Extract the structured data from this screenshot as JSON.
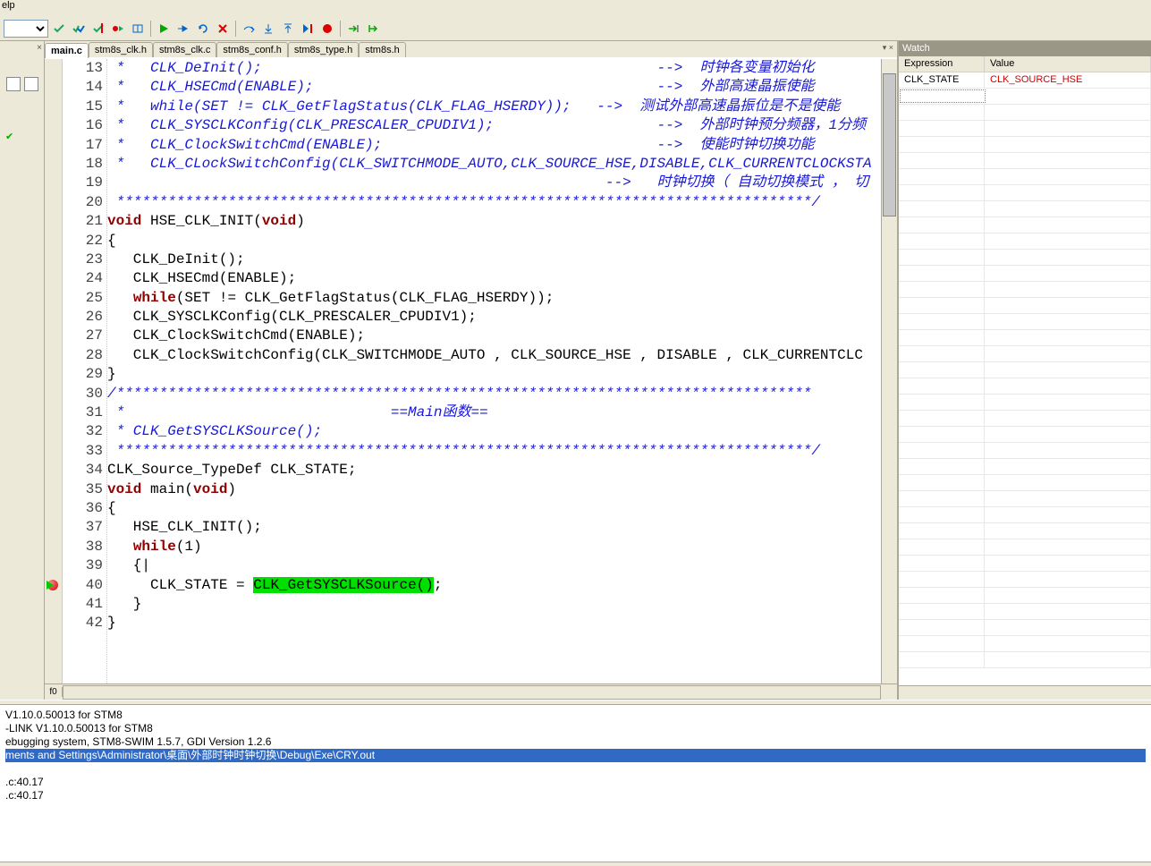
{
  "menubar": {
    "item_visible": "elp"
  },
  "tabs": [
    {
      "label": "main.c",
      "active": true
    },
    {
      "label": "stm8s_clk.h",
      "active": false
    },
    {
      "label": "stm8s_clk.c",
      "active": false
    },
    {
      "label": "stm8s_conf.h",
      "active": false
    },
    {
      "label": "stm8s_type.h",
      "active": false
    },
    {
      "label": "stm8s.h",
      "active": false
    }
  ],
  "code": {
    "first_line": 13,
    "lines": [
      {
        "n": 13,
        "type": "comment",
        "text": " *   CLK_DeInit();                                              -->  时钟各变量初始化"
      },
      {
        "n": 14,
        "type": "comment",
        "text": " *   CLK_HSECmd(ENABLE);                                        -->  外部高速晶振使能"
      },
      {
        "n": 15,
        "type": "comment",
        "text": " *   while(SET != CLK_GetFlagStatus(CLK_FLAG_HSERDY));   -->  测试外部高速晶振位是不是使能"
      },
      {
        "n": 16,
        "type": "comment",
        "text": " *   CLK_SYSCLKConfig(CLK_PRESCALER_CPUDIV1);                   -->  外部时钟预分频器，1分频"
      },
      {
        "n": 17,
        "type": "comment",
        "text": " *   CLK_ClockSwitchCmd(ENABLE);                                -->  使能时钟切换功能"
      },
      {
        "n": 18,
        "type": "comment",
        "text": " *   CLK_CLockSwitchConfig(CLK_SWITCHMODE_AUTO,CLK_SOURCE_HSE,DISABLE,CLK_CURRENTCLOCKSTA"
      },
      {
        "n": 19,
        "type": "comment",
        "text": "                                                          -->   时钟切换（ 自动切换模式 ， 切"
      },
      {
        "n": 20,
        "type": "comment",
        "text": " *********************************************************************************/"
      },
      {
        "n": 21,
        "type": "decl",
        "pre": "",
        "kw1": "void",
        "mid": " HSE_CLK_INIT(",
        "kw2": "void",
        "post": ")"
      },
      {
        "n": 22,
        "type": "plain",
        "text": "{"
      },
      {
        "n": 23,
        "type": "plain",
        "text": "   CLK_DeInit();"
      },
      {
        "n": 24,
        "type": "plain",
        "text": "   CLK_HSECmd(ENABLE);"
      },
      {
        "n": 25,
        "type": "while",
        "pre": "   ",
        "kw": "while",
        "post": "(SET != CLK_GetFlagStatus(CLK_FLAG_HSERDY));"
      },
      {
        "n": 26,
        "type": "plain",
        "text": "   CLK_SYSCLKConfig(CLK_PRESCALER_CPUDIV1);"
      },
      {
        "n": 27,
        "type": "plain",
        "text": "   CLK_ClockSwitchCmd(ENABLE);"
      },
      {
        "n": 28,
        "type": "plain",
        "text": "   CLK_ClockSwitchConfig(CLK_SWITCHMODE_AUTO , CLK_SOURCE_HSE , DISABLE , CLK_CURRENTCLC"
      },
      {
        "n": 29,
        "type": "plain",
        "text": "}"
      },
      {
        "n": 30,
        "type": "comment",
        "text": "/*********************************************************************************"
      },
      {
        "n": 31,
        "type": "comment",
        "text": " *                               ==Main函数=="
      },
      {
        "n": 32,
        "type": "comment",
        "text": " * CLK_GetSYSCLKSource();"
      },
      {
        "n": 33,
        "type": "comment",
        "text": " *********************************************************************************/"
      },
      {
        "n": 34,
        "type": "plain",
        "text": "CLK_Source_TypeDef CLK_STATE;"
      },
      {
        "n": 35,
        "type": "decl",
        "pre": "",
        "kw1": "void",
        "mid": " main(",
        "kw2": "void",
        "post": ")"
      },
      {
        "n": 36,
        "type": "plain",
        "text": "{"
      },
      {
        "n": 37,
        "type": "plain",
        "text": "   HSE_CLK_INIT();"
      },
      {
        "n": 38,
        "type": "while",
        "pre": "   ",
        "kw": "while",
        "post": "(1)"
      },
      {
        "n": 39,
        "type": "plain",
        "text": "   {|"
      },
      {
        "n": 40,
        "type": "hilite",
        "pre": "     CLK_STATE = ",
        "hl": "CLK_GetSYSCLKSource()",
        "post": ";",
        "bp": true
      },
      {
        "n": 41,
        "type": "plain",
        "text": "   }"
      },
      {
        "n": 42,
        "type": "plain",
        "text": "}"
      }
    ]
  },
  "editor_footer": {
    "fn": "f0"
  },
  "watch": {
    "title": "Watch",
    "columns": {
      "expression": "Expression",
      "value": "Value"
    },
    "rows": [
      {
        "expression": "CLK_STATE",
        "value": "CLK_SOURCE_HSE",
        "red": true
      }
    ]
  },
  "output": {
    "lines": [
      " V1.10.0.50013 for STM8",
      "-LINK V1.10.0.50013 for STM8",
      "ebugging system, STM8-SWIM 1.5.7, GDI Version 1.2.6"
    ],
    "selected_line": "ments and Settings\\Administrator\\桌面\\外部时钟时钟切换\\Debug\\Exe\\CRY.out",
    "lines_after": [
      "",
      ".c:40.17",
      ".c:40.17"
    ]
  }
}
